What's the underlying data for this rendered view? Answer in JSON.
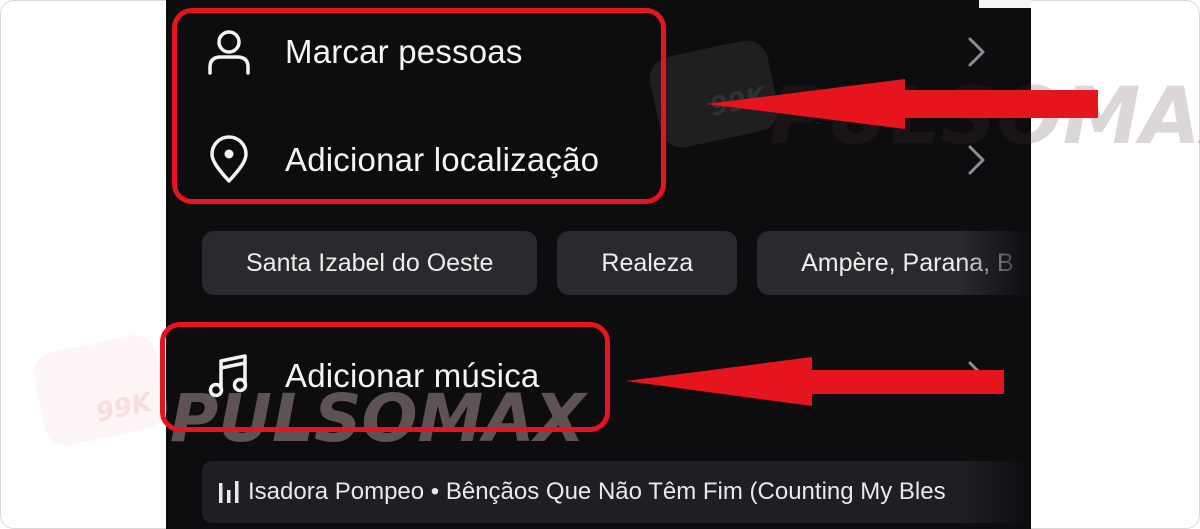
{
  "menu": {
    "tag_people": {
      "label": "Marcar pessoas",
      "icon": "person-icon",
      "chevron": "chevron-right-icon"
    },
    "add_location": {
      "label": "Adicionar localização",
      "icon": "location-pin-icon",
      "chevron": "chevron-right-icon"
    },
    "add_music": {
      "label": "Adicionar música",
      "icon": "music-note-icon",
      "chevron": "chevron-right-icon"
    }
  },
  "location_suggestions": [
    "Santa Izabel do Oeste",
    "Realeza",
    "Ampère, Parana, B"
  ],
  "music_suggestion": {
    "icon": "equalizer-icon",
    "text": "Isadora Pompeo • Bênçãos Que Não Têm Fim (Counting My Bles"
  },
  "watermark": {
    "brand": "PULSOMAX",
    "badge": "99K"
  },
  "colors": {
    "annotation_red": "#e5141d",
    "app_background": "#0d0d10",
    "chip_background": "#2a2a2e",
    "text": "#f4f4f4"
  }
}
